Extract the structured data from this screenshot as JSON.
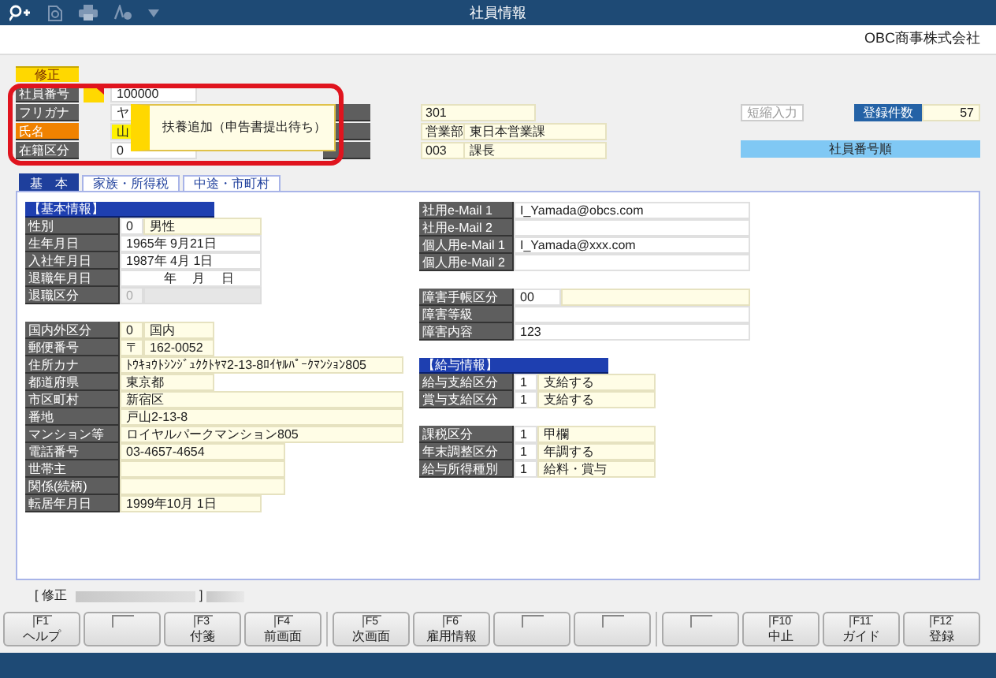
{
  "toolbar": {
    "title": "社員情報"
  },
  "company": "OBC商事株式会社",
  "mode_badge": "修正",
  "header_rows": [
    {
      "label": "社員番号",
      "highlight": false,
      "code": "100000"
    },
    {
      "label": "フリガナ",
      "highlight": false,
      "code": "ヤ"
    },
    {
      "label": "氏名",
      "highlight": true,
      "code": "山"
    },
    {
      "label": "在籍区分",
      "highlight": false,
      "code": "0"
    }
  ],
  "assignment_rows": [
    {
      "code": "301"
    },
    {
      "code": "営業部",
      "name": "東日本営業課"
    },
    {
      "code": "003",
      "name": "課長"
    }
  ],
  "tooltip": "扶養追加（申告書提出待ち）",
  "shortcut_button": "短縮入力",
  "count": {
    "label": "登録件数",
    "value": "57"
  },
  "sort_order": "社員番号順",
  "tabs": [
    {
      "label": "基　本",
      "selected": true
    },
    {
      "label": "家族・所得税",
      "selected": false
    },
    {
      "label": "中途・市町村",
      "selected": false
    }
  ],
  "left_sections": [
    {
      "title": "【基本情報】",
      "rows": [
        {
          "label": "性別",
          "kind": "select",
          "code": "0",
          "text": "男性"
        },
        {
          "label": "生年月日",
          "kind": "date",
          "text": "1965年 9月21日"
        },
        {
          "label": "入社年月日",
          "kind": "date",
          "text": "1987年 4月 1日"
        },
        {
          "label": "退職年月日",
          "kind": "date",
          "text": "　　　年　 月　 日"
        },
        {
          "label": "退職区分",
          "kind": "disabled",
          "code": "0"
        }
      ]
    },
    {
      "rows": [
        {
          "label": "国内外区分",
          "kind": "short_pair",
          "code": "0",
          "text": "国内"
        },
        {
          "label": "郵便番号",
          "kind": "short_pair",
          "code": "〒",
          "text": "162-0052"
        },
        {
          "label": "住所カナ",
          "kind": "long",
          "text": "ﾄｳｷｮｳﾄｼﾝｼﾞｭｸｸﾄﾔﾏ2-13-8ﾛｲﾔﾙﾊﾟｰｸﾏﾝｼｮﾝ805"
        },
        {
          "label": "都道府県",
          "kind": "short",
          "text": "東京都"
        },
        {
          "label": "市区町村",
          "kind": "long",
          "text": "新宿区"
        },
        {
          "label": "番地",
          "kind": "long",
          "text": "戸山2-13-8"
        },
        {
          "label": "マンション等",
          "kind": "long",
          "text": "ロイヤルパークマンション805"
        },
        {
          "label": "電話番号",
          "kind": "medium",
          "text": "03-4657-4654"
        },
        {
          "label": "世帯主",
          "kind": "medium"
        },
        {
          "label": "関係(続柄)",
          "kind": "medium"
        },
        {
          "label": "転居年月日",
          "kind": "date_filled",
          "text": "1999年10月 1日"
        }
      ]
    }
  ],
  "right_sections": [
    {
      "rows": [
        {
          "label": "社用e-Mail 1",
          "kind": "email",
          "text": "I_Yamada@obcs.com"
        },
        {
          "label": "社用e-Mail 2",
          "kind": "email"
        },
        {
          "label": "個人用e-Mail 1",
          "kind": "email",
          "text": "I_Yamada@xxx.com"
        },
        {
          "label": "個人用e-Mail 2",
          "kind": "email"
        }
      ]
    },
    {
      "rows": [
        {
          "label": "障害手帳区分",
          "kind": "wide_pair",
          "code": "00"
        },
        {
          "label": "障害等級",
          "kind": "email"
        },
        {
          "label": "障害内容",
          "kind": "email",
          "text": "123"
        }
      ]
    },
    {
      "title": "【給与情報】",
      "rows": [
        {
          "label": "給与支給区分",
          "kind": "select",
          "code": "1",
          "text": "支給する"
        },
        {
          "label": "賞与支給区分",
          "kind": "select",
          "code": "1",
          "text": "支給する"
        }
      ]
    },
    {
      "rows": [
        {
          "label": "課税区分",
          "kind": "select",
          "code": "1",
          "text": "甲欄"
        },
        {
          "label": "年末調整区分",
          "kind": "select",
          "code": "1",
          "text": "年調する"
        },
        {
          "label": "給与所得種別",
          "kind": "select",
          "code": "1",
          "text": "給料・賞与"
        }
      ]
    }
  ],
  "status": {
    "mode": "[ 修正",
    "close": "]"
  },
  "function_keys": [
    {
      "kind": "key",
      "key": "F1",
      "label": "ヘルプ"
    },
    {
      "kind": "blank"
    },
    {
      "kind": "key",
      "key": "F3",
      "label": "付箋"
    },
    {
      "kind": "key",
      "key": "F4",
      "label": "前画面"
    },
    {
      "kind": "key",
      "key": "F5",
      "label": "次画面"
    },
    {
      "kind": "key",
      "key": "F6",
      "label": "雇用情報"
    },
    {
      "kind": "blank"
    },
    {
      "kind": "blank"
    },
    {
      "kind": "blank"
    },
    {
      "kind": "key",
      "key": "F10",
      "label": "中止"
    },
    {
      "kind": "key",
      "key": "F11",
      "label": "ガイド"
    },
    {
      "kind": "key",
      "key": "F12",
      "label": "登録"
    }
  ]
}
